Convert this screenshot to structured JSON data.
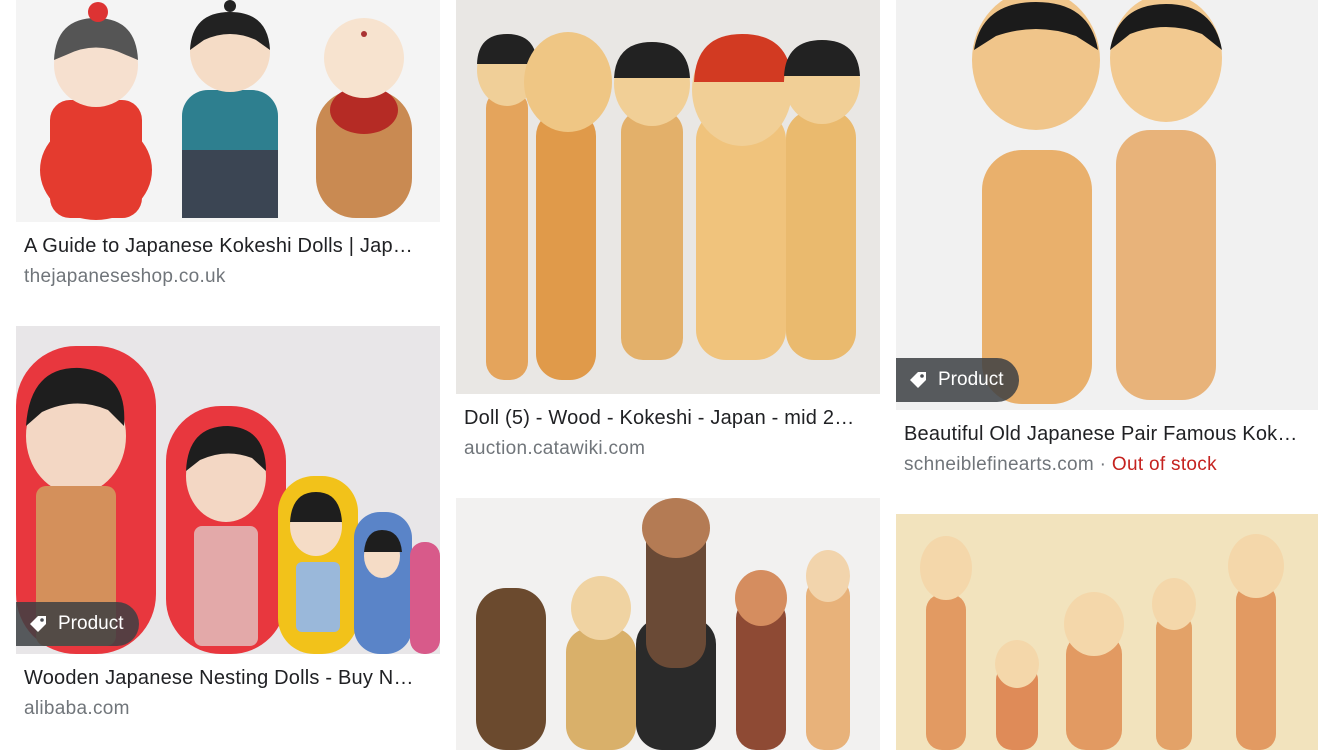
{
  "results": [
    {
      "title": "A Guide to Japanese Kokeshi Dolls | Japa…",
      "source": "thejapaneseshop.co.uk"
    },
    {
      "title": "Wooden Japanese Nesting Dolls - Buy Nes…",
      "source": "alibaba.com",
      "badge": "Product"
    },
    {
      "title": "Doll (5) - Wood - Kokeshi - Japan - mid 20t…",
      "source": "auction.catawiki.com"
    },
    {
      "title": "Beautiful Old Japanese Pair Famous Koke…",
      "source": "schneiblefinearts.com",
      "separator": "·",
      "stock_status": "Out of stock",
      "badge": "Product"
    }
  ],
  "icons": {
    "close": "close-icon",
    "tag": "tag-icon"
  },
  "colors": {
    "title": "#202124",
    "source": "#70757a",
    "out_of_stock": "#c5221f",
    "badge_bg": "#3c4043"
  }
}
